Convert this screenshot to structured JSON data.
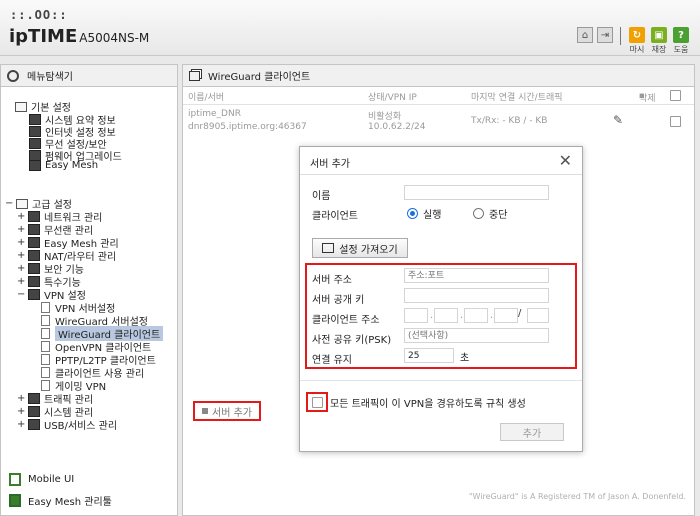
{
  "header": {
    "logo_dots": "::.OO::",
    "logo_brand": "ipTIME",
    "logo_model": "A5004NS-M",
    "buttons": [
      {
        "label": "마시",
        "icon": "refresh-icon",
        "color": "#f0a000"
      },
      {
        "label": "재장",
        "icon": "save-icon",
        "color": "#7ab020"
      },
      {
        "label": "도움",
        "icon": "help-icon",
        "color": "#4aa030"
      }
    ]
  },
  "sidebar": {
    "title": "메뉴탐색기",
    "basic": {
      "label": "기본 설정",
      "items": [
        "시스템 요약 정보",
        "인터넷 설정 정보",
        "무선 설정/보안",
        "펌웨어 업그레이드",
        "Easy Mesh"
      ]
    },
    "advanced": {
      "label": "고급 설정",
      "items": [
        "네트워크 관리",
        "무선랜 관리",
        "Easy Mesh 관리",
        "NAT/라우터 관리",
        "보안 기능",
        "특수기능",
        "VPN 설정"
      ],
      "vpn_items": [
        "VPN 서버설정",
        "WireGuard 서버설정",
        "WireGuard 클라이언트",
        "OpenVPN 클라이언트",
        "PPTP/L2TP 클라이언트",
        "클라이언트 사용 관리",
        "게이밍 VPN"
      ],
      "after_items": [
        "트래픽 관리",
        "시스템 관리",
        "USB/서비스 관리"
      ]
    },
    "bottom": [
      "Mobile UI",
      "Easy Mesh 관리툴"
    ]
  },
  "main": {
    "title": "WireGuard 클라이언트",
    "columns": [
      "이름/서버",
      "상태/VPN IP",
      "마지막 연결 시간/트래픽",
      "삭제"
    ],
    "rows": [
      {
        "name": "iptime_DNR",
        "server": "dnr8905.iptime.org:46367",
        "status": "비활성화",
        "vpn_ip": "10.0.62.2/24",
        "traffic": "Tx/Rx: - KB / - KB"
      }
    ],
    "add_server": "서버 추가",
    "footnote": "\"WireGuard\" is A Registered TM of Jason A. Donenfeld."
  },
  "modal": {
    "title": "서버 추가",
    "name_label": "이름",
    "client_label": "클라이언트",
    "radio_on": "실행",
    "radio_off": "중단",
    "import_button": "설정 가져오기",
    "server_addr_label": "서버 주소",
    "server_addr_placeholder": "주소:포트",
    "pubkey_label": "서버 공개 키",
    "client_addr_label": "클라이언트 주소",
    "psk_label": "사전 공유 키(PSK)",
    "psk_placeholder": "(선택사항)",
    "keepalive_label": "연결 유지",
    "keepalive_value": "25",
    "keepalive_unit": "초",
    "route_all_label": "모든 트래픽이 이 VPN을 경유하도록 규칙 생성",
    "add_button": "추가"
  }
}
